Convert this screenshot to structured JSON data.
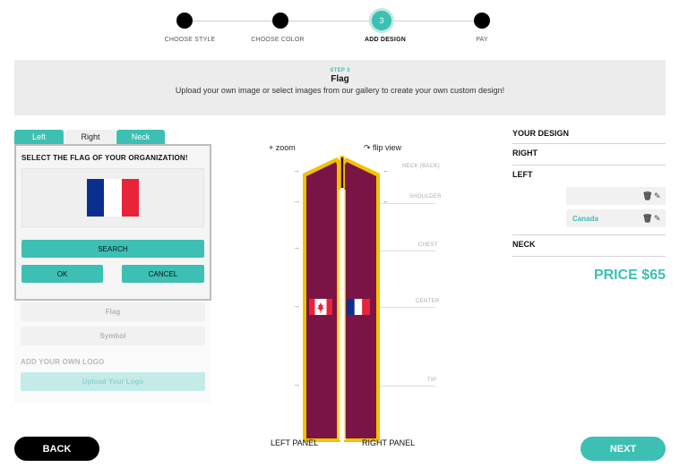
{
  "stepper": {
    "steps": [
      {
        "label": "CHOOSE STYLE"
      },
      {
        "label": "CHOOSE COLOR"
      },
      {
        "label": "ADD DESIGN",
        "number": "3"
      },
      {
        "label": "PAY"
      }
    ]
  },
  "banner": {
    "kicker": "STEP 3",
    "title": "Flag",
    "description": "Upload your own image or select images from our gallery to create your own custom design!"
  },
  "tabs": {
    "left": "Left",
    "right": "Right",
    "neck": "Neck"
  },
  "flag_panel": {
    "heading": "SELECT THE FLAG OF YOUR ORGANIZATION!",
    "search_label": "SEARCH",
    "ok_label": "OK",
    "cancel_label": "CANCEL"
  },
  "options": {
    "flag_label": "Flag",
    "symbol_label": "Symbol",
    "logo_heading": "ADD YOUR OWN LOGO",
    "upload_label": "Upload Your Logo"
  },
  "stole": {
    "zoom_label": "+ zoom",
    "flip_label": "↷ flip view",
    "annotations": [
      "NECK (BACK)",
      "SHOULDER",
      "CHEST",
      "CENTER",
      "TIP"
    ],
    "left_panel_label": "LEFT PANEL",
    "right_panel_label": "RIGHT PANEL"
  },
  "design": {
    "heading": "YOUR DESIGN",
    "right_label": "RIGHT",
    "left_label": "LEFT",
    "left_items": [
      "",
      "Canada"
    ],
    "neck_label": "NECK"
  },
  "price": "PRICE $65",
  "nav": {
    "back_label": "BACK",
    "next_label": "NEXT"
  },
  "colors": {
    "accent": "#3dbfb3",
    "stole": "#7a1446",
    "trim": "#f2c200"
  }
}
